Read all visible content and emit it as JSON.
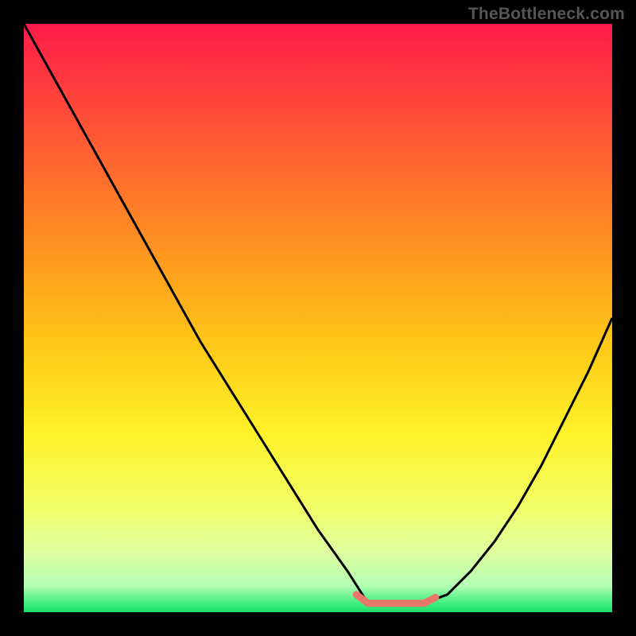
{
  "watermark": "TheBottleneck.com",
  "chart_data": {
    "type": "line",
    "title": "",
    "xlabel": "",
    "ylabel": "",
    "xlim": [
      0,
      1
    ],
    "ylim": [
      0,
      1
    ],
    "series": [
      {
        "name": "curve",
        "x": [
          0.0,
          0.05,
          0.1,
          0.15,
          0.2,
          0.25,
          0.3,
          0.35,
          0.4,
          0.45,
          0.5,
          0.55,
          0.585,
          0.63,
          0.68,
          0.72,
          0.76,
          0.8,
          0.84,
          0.88,
          0.92,
          0.96,
          1.0
        ],
        "y": [
          1.0,
          0.91,
          0.82,
          0.73,
          0.64,
          0.55,
          0.46,
          0.38,
          0.3,
          0.22,
          0.14,
          0.07,
          0.015,
          0.015,
          0.015,
          0.03,
          0.07,
          0.12,
          0.18,
          0.25,
          0.33,
          0.41,
          0.5
        ]
      },
      {
        "name": "valley-highlight",
        "x": [
          0.565,
          0.585,
          0.63,
          0.68,
          0.7
        ],
        "y": [
          0.03,
          0.015,
          0.015,
          0.015,
          0.025
        ]
      }
    ],
    "gradient_stops": [
      {
        "offset": 0.0,
        "color": "#ff1a4b"
      },
      {
        "offset": 0.1,
        "color": "#ff3b3e"
      },
      {
        "offset": 0.25,
        "color": "#ff6a2e"
      },
      {
        "offset": 0.4,
        "color": "#ff9a1f"
      },
      {
        "offset": 0.55,
        "color": "#ffc917"
      },
      {
        "offset": 0.7,
        "color": "#fff32a"
      },
      {
        "offset": 0.82,
        "color": "#f3ff68"
      },
      {
        "offset": 0.9,
        "color": "#dcffa0"
      },
      {
        "offset": 0.955,
        "color": "#b4ffb4"
      },
      {
        "offset": 0.985,
        "color": "#3fe f7f"
      },
      {
        "offset": 1.0,
        "color": "#18e066"
      }
    ],
    "colors": {
      "curve": "#000000",
      "highlight": "#e8786b",
      "frame": "#000000"
    }
  }
}
